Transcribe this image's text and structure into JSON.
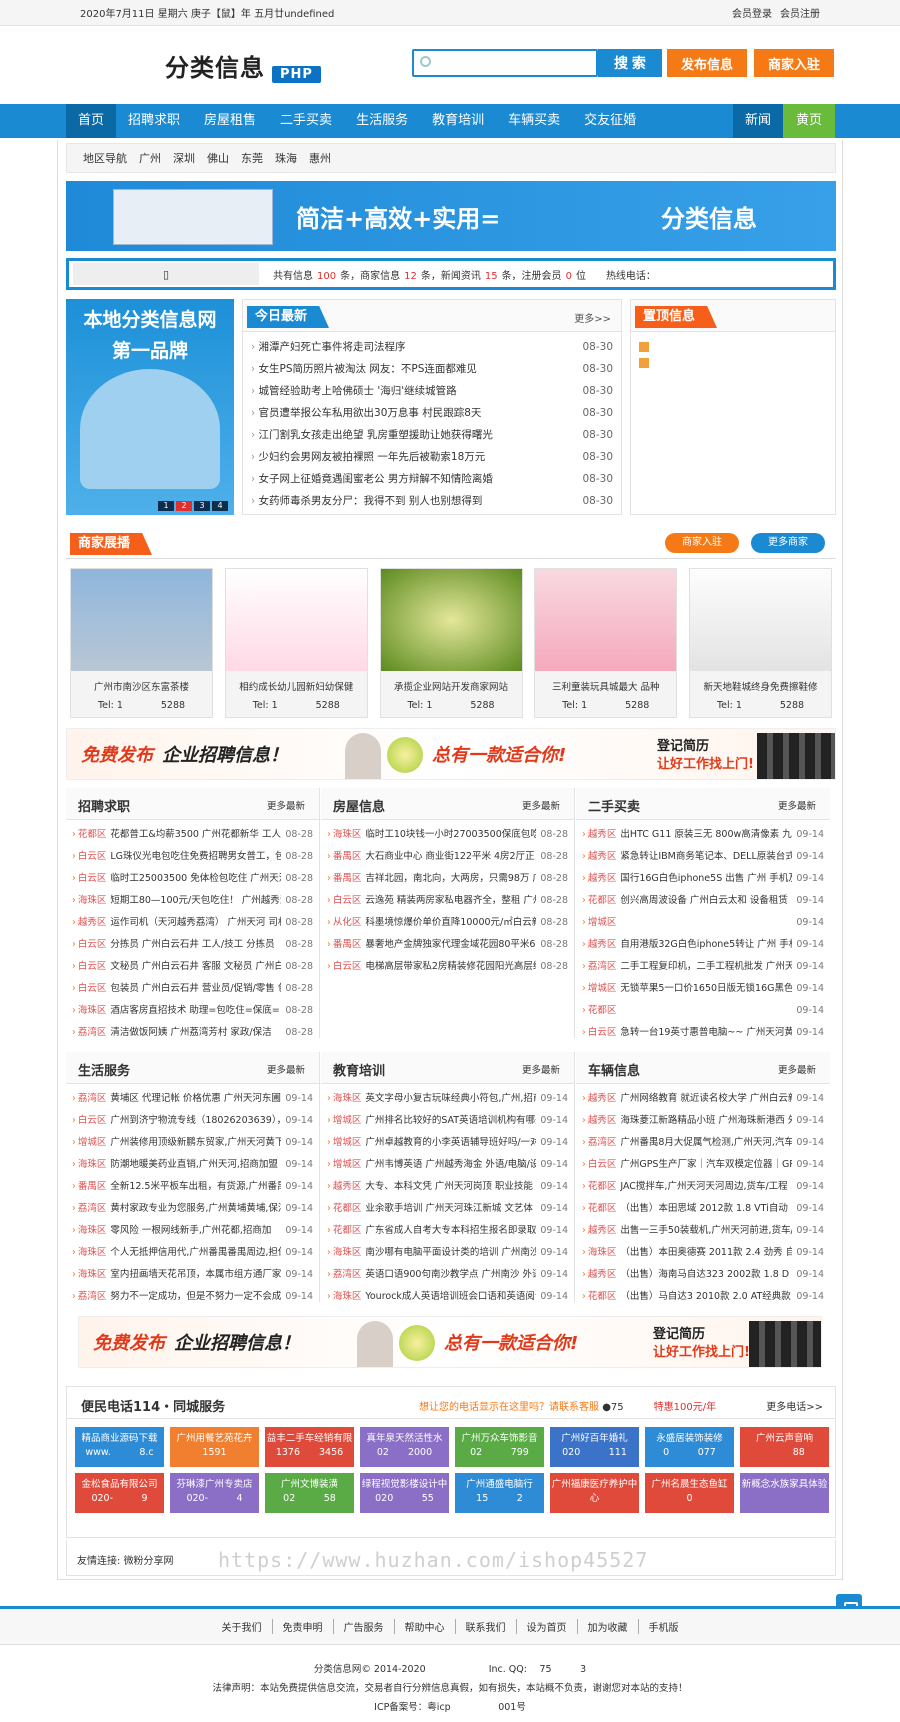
{
  "topbar": {
    "date": "2020年7月11日 星期六 庚子【鼠】年 五月廿undefined",
    "login": "会员登录",
    "register": "会员注册"
  },
  "header": {
    "logo": "分类信息",
    "logo_badge": "PHP",
    "search_placeholder": "",
    "search_btn": "搜 索",
    "post_btn": "发布信息",
    "biz_btn": "商家入驻"
  },
  "nav": {
    "items": [
      "首页",
      "招聘求职",
      "房屋租售",
      "二手买卖",
      "生活服务",
      "教育培训",
      "车辆买卖",
      "交友征婚"
    ],
    "news": "新闻",
    "yellow": "黄页"
  },
  "region": {
    "label": "地区导航",
    "cities": [
      "广州",
      "深圳",
      "佛山",
      "东莞",
      "珠海",
      "惠州"
    ]
  },
  "banner": {
    "slogan": "简洁+高效+实用=",
    "slogan2": "分类信息"
  },
  "stats": {
    "prefix": "共有信息",
    "info": "100",
    "mid1": "条，商家信息",
    "biz": "12",
    "mid2": "条，新闻资讯",
    "news": "15",
    "mid3": "条，注册会员",
    "members": "0",
    "suffix": "位",
    "hotline": "热线电话："
  },
  "promo": {
    "line1": "本地分类信息网",
    "line2": "第一品牌",
    "dots": [
      "1",
      "2",
      "3",
      "4"
    ]
  },
  "today": {
    "title": "今日最新",
    "more": "更多>>",
    "items": [
      {
        "t": "湘潭产妇死亡事件将走司法程序",
        "d": "08-30"
      },
      {
        "t": "女生PS简历照片被淘汰 网友：不PS连面都难见",
        "d": "08-30"
      },
      {
        "t": "城管经验助考上哈佛硕士 '海归'继续城管路",
        "d": "08-30"
      },
      {
        "t": "官员遭举报公车私用欲出30万息事 村民跟踪8天",
        "d": "08-30"
      },
      {
        "t": "江门割乳女孩走出绝望 乳房重塑援助让她获得曙光",
        "d": "08-30"
      },
      {
        "t": "少妇约会男网友被拍裸照 一年先后被勒索18万元",
        "d": "08-30"
      },
      {
        "t": "女子网上征婚竟遇闺蜜老公 男方辩解不知情险离婚",
        "d": "08-30"
      },
      {
        "t": "女药师毒杀男友分尸：我得不到 别人也别想得到",
        "d": "08-30"
      }
    ]
  },
  "top_info": {
    "title": "置顶信息"
  },
  "showcase": {
    "title": "商家展播",
    "btn1": "商家入驻",
    "btn2": "更多商家",
    "cards": [
      {
        "name": "广州市南沙区东富茶楼",
        "tel": "Tel: 1　　　　5288"
      },
      {
        "name": "相约成长幼儿园新妇幼保健",
        "tel": "Tel: 1　　　　5288"
      },
      {
        "name": "承揽企业网站开发商家网站",
        "tel": "Tel: 1　　　　5288"
      },
      {
        "name": "三利童装玩具城最大 品种",
        "tel": "Tel: 1　　　　5288"
      },
      {
        "name": "新天地鞋城终身免费擦鞋修",
        "tel": "Tel: 1　　　　5288"
      }
    ]
  },
  "ad": {
    "a1": "免费发布",
    "a2": "企业招聘信息！",
    "a3": "总有一款适合你!",
    "a4": "登记简历",
    "a5": "让好工作找上门!"
  },
  "categories": [
    {
      "name": "招聘求职",
      "more": "更多最新",
      "items": [
        {
          "r": "花都区",
          "t": "花都普工&均薪3500 广州花都新华 工人/技",
          "d": "08-28"
        },
        {
          "r": "白云区",
          "t": "LG珠仪光电包吃住免费招聘男女普工，包",
          "d": "08-28"
        },
        {
          "r": "白云区",
          "t": "临时工25003500 免体检包吃住 广州天河",
          "d": "08-28"
        },
        {
          "r": "海珠区",
          "t": "短期工80—100元/天包吃住！ 广州越秀流",
          "d": "08-28"
        },
        {
          "r": "越秀区",
          "t": "运作司机（天河越秀荔湾） 广州天河 司机",
          "d": "08-28"
        },
        {
          "r": "白云区",
          "t": "分拣员 广州白云石井 工人/技工 分拣员",
          "d": "08-28"
        },
        {
          "r": "白云区",
          "t": "文秘员 广州白云石井 客服 文秘员 广州白",
          "d": "08-28"
        },
        {
          "r": "白云区",
          "t": "包装员 广州白云石井 营业员/促销/零售 包",
          "d": "08-28"
        },
        {
          "r": "海珠区",
          "t": "酒店客房直招技术 助理=包吃住=保底=日",
          "d": "08-28"
        },
        {
          "r": "荔湾区",
          "t": "清洁做饭阿姨 广州荔湾芳村 家政/保洁",
          "d": "08-28"
        }
      ]
    },
    {
      "name": "房屋信息",
      "more": "更多最新",
      "items": [
        {
          "r": "海珠区",
          "t": "临时工10块钱一小时27003500保底包吃",
          "d": "08-28"
        },
        {
          "r": "番禺区",
          "t": "大石商业中心 商业街122平米 4房2厅正",
          "d": "08-28"
        },
        {
          "r": "番禺区",
          "t": "吉祥北园，南北向，大两房，只需98万 广",
          "d": "08-28"
        },
        {
          "r": "白云区",
          "t": "云逸苑 精装两房家私电器齐全，整租 广州",
          "d": "08-28"
        },
        {
          "r": "从化区",
          "t": "科墨境惊爆价单价直降10000元/㎡白云新",
          "d": "08-28"
        },
        {
          "r": "番禺区",
          "t": "暴奢地产金牌独家代理金域花园80平米69",
          "d": "08-28"
        },
        {
          "r": "白云区",
          "t": "电梯高层带家私2房精装修花园阳光高层绿",
          "d": "08-28"
        }
      ]
    },
    {
      "name": "二手买卖",
      "more": "更多最新",
      "items": [
        {
          "r": "越秀区",
          "t": "出HTC G11 原装三无 800w高清像素 九新",
          "d": "09-14"
        },
        {
          "r": "越秀区",
          "t": "紧急转让IBM商务笔记本、DELL原装台式",
          "d": "09-14"
        },
        {
          "r": "越秀区",
          "t": "国行16G白色iphone5S 出售 广州 手机及",
          "d": "09-14"
        },
        {
          "r": "花都区",
          "t": "创兴高周波设备 广州白云太和 设备租赁",
          "d": "09-14"
        },
        {
          "r": "增城区",
          "t": "",
          "d": "09-14"
        },
        {
          "r": "越秀区",
          "t": "自用港版32G白色iphone5转让 广州 手机",
          "d": "09-14"
        },
        {
          "r": "荔湾区",
          "t": "二手工程复印机，二手工程机批发 广州天",
          "d": "09-14"
        },
        {
          "r": "增城区",
          "t": "无锁苹果5一口价1650日版无锁16G黑色",
          "d": "09-14"
        },
        {
          "r": "花都区",
          "t": "",
          "d": "09-14"
        },
        {
          "r": "白云区",
          "t": "急转一台19英寸惠普电脑~~ 广州天河黄下",
          "d": "09-14"
        }
      ]
    },
    {
      "name": "生活服务",
      "more": "更多最新",
      "items": [
        {
          "r": "荔湾区",
          "t": "黄埔区 代理记帐 价格优惠 广州天河东圃、",
          "d": "09-14"
        },
        {
          "r": "白云区",
          "t": "广州到济宁物流专线（18026203639），广",
          "d": "09-14"
        },
        {
          "r": "增城区",
          "t": "广州装修用顶级新鹏东贸家,广州天河黄下、",
          "d": "09-14"
        },
        {
          "r": "海珠区",
          "t": "防潮地暖美药业直销,广州天河,招商加盟",
          "d": "09-14"
        },
        {
          "r": "番禺区",
          "t": "全新12.5米平板车出租，有货源,广州番禺、",
          "d": "09-14"
        },
        {
          "r": "荔湾区",
          "t": "黄村家政专业为您服务,广州黄埔黄埔,保洁/",
          "d": "09-14"
        },
        {
          "r": "海珠区",
          "t": "零风险 一根网线新手,广州花都,招商加",
          "d": "09-14"
        },
        {
          "r": "海珠区",
          "t": "个人无抵押信用代,广州番禺番禺周边,担保/",
          "d": "09-14"
        },
        {
          "r": "海珠区",
          "t": "室内扭画墙天花吊顶，本属市组方通厂家、",
          "d": "09-14"
        },
        {
          "r": "荔湾区",
          "t": "努力不一定成功，但是不努力一定不会成",
          "d": "09-14"
        }
      ]
    },
    {
      "name": "教育培训",
      "more": "更多最新",
      "items": [
        {
          "r": "海珠区",
          "t": "英文字母小复古玩味经典小符包,广州,招商",
          "d": "09-14"
        },
        {
          "r": "增城区",
          "t": "广州排名比较好的SAT英语培训机构有哪些",
          "d": "09-14"
        },
        {
          "r": "增城区",
          "t": "广州卓越教育的小李英语辅导班好吗/一对一补",
          "d": "09-14"
        },
        {
          "r": "增城区",
          "t": "广州韦博英语 广州越秀海金 外语/电脑/设",
          "d": "09-14"
        },
        {
          "r": "越秀区",
          "t": "大专、本科文凭 广州天河岗顶 职业技能",
          "d": "09-14"
        },
        {
          "r": "花都区",
          "t": "业余歌手培训 广州天河珠江新城 文艺体",
          "d": "09-14"
        },
        {
          "r": "花都区",
          "t": "广东省成人自考大专本科招生报名即录取",
          "d": "09-14"
        },
        {
          "r": "海珠区",
          "t": "南沙哪有电脑平面设计类的培训 广州南沙",
          "d": "09-14"
        },
        {
          "r": "荔湾区",
          "t": "英语口语900句南沙教学点 广州南沙 外语/",
          "d": "09-14"
        },
        {
          "r": "海珠区",
          "t": "Yourock成人英语培训班会口语和英语阅读",
          "d": "09-14"
        }
      ]
    },
    {
      "name": "车辆信息",
      "more": "更多最新",
      "items": [
        {
          "r": "越秀区",
          "t": "广州网络教育 就近读名校大学 广州白云新",
          "d": "09-14"
        },
        {
          "r": "越秀区",
          "t": "海珠菱江新路精品小班 广州海珠新港西 外",
          "d": "09-14"
        },
        {
          "r": "荔湾区",
          "t": "广州番禺8月大促属气检测,广州天河,汽车",
          "d": "09-14"
        },
        {
          "r": "白云区",
          "t": "广州GPS生产厂家｜汽车双模定位器｜GP",
          "d": "09-14"
        },
        {
          "r": "花都区",
          "t": "JAC搅拌车,广州天河天河周边,货车/工程",
          "d": "09-14"
        },
        {
          "r": "花都区",
          "t": "（出售）本田思域 2012款 1.8 VTi自动",
          "d": "09-14"
        },
        {
          "r": "越秀区",
          "t": "出售一三手50装载机,广州天河前进,货车/工",
          "d": "09-14"
        },
        {
          "r": "海珠区",
          "t": "（出售）本田奥德赛 2011款 2.4 劲秀 自",
          "d": "09-14"
        },
        {
          "r": "越秀区",
          "t": "（出售）海南马自达323 2002款 1.8 D",
          "d": "09-14"
        },
        {
          "r": "花都区",
          "t": "（出售）马自达3 2010款 2.0 AT经典款",
          "d": "09-14"
        }
      ]
    }
  ],
  "service": {
    "title": "便民电话114・同城服务",
    "question": "想让您的电话显示在这里吗？请联系客服",
    "phone": "75",
    "price": "特惠100元/年",
    "more": "更多电话>>",
    "tiles": [
      {
        "name": "精品商业源码下载",
        "tel": "www.　　　8.c",
        "color": "#2e8bd6"
      },
      {
        "name": "广州用餐艺苑花卉",
        "tel": "1591　　　",
        "color": "#f08030"
      },
      {
        "name": "益丰二手车经销有限",
        "tel": "1376　　3456",
        "color": "#e04a3a"
      },
      {
        "name": "真年泉天然活性水",
        "tel": "02　　2000",
        "color": "#8b6fc6"
      },
      {
        "name": "广州万众车饰影音",
        "tel": "02　　　799",
        "color": "#5aaa45"
      },
      {
        "name": "广州好百年婚礼",
        "tel": "020　　　111",
        "color": "#3b73c8"
      },
      {
        "name": "永盛居装饰装修",
        "tel": "0　　　077",
        "color": "#2e8bd6"
      },
      {
        "name": "广州云声音响",
        "tel": "　　　88",
        "color": "#e04a3a"
      },
      {
        "name": "金松食品有限公司",
        "tel": "020-　　　9",
        "color": "#e04a3a"
      },
      {
        "name": "芬琳漆广州专卖店",
        "tel": "020-　　　4",
        "color": "#8b6fc6"
      },
      {
        "name": "广州文博装潢",
        "tel": "02　　　58",
        "color": "#5aaa45"
      },
      {
        "name": "绿程视觉影楼设计中",
        "tel": "020　　　55",
        "color": "#8b6fc6"
      },
      {
        "name": "广州通盛电脑行",
        "tel": "15　　　2",
        "color": "#2e8bd6"
      },
      {
        "name": "广州福康医疗养护中心",
        "tel": "",
        "color": "#e04a3a"
      },
      {
        "name": "广州名晨生态鱼缸",
        "tel": "0　　　",
        "color": "#e04a3a"
      },
      {
        "name": "新概念水族家具体验",
        "tel": "　　　",
        "color": "#8b6fc6"
      }
    ]
  },
  "friends": {
    "label": "友情连接:",
    "link": "微粉分享网"
  },
  "watermark": "https://www.huzhan.com/ishop45527",
  "footer": {
    "links": [
      "关于我们",
      "免责申明",
      "广告服务",
      "帮助中心",
      "联系我们",
      "设为首页",
      "加为收藏",
      "手机版"
    ],
    "copyright": "分类信息网© 2014-2020 　　　　　　 Inc. QQ: 　75　　　3",
    "legal": "法律声明：本站免费提供信息交流，交易者自行分辨信息真假，如有损失，本站概不负责，谢谢您对本站的支持！",
    "icp": "ICP备案号：粤icp　　　　　001号"
  }
}
